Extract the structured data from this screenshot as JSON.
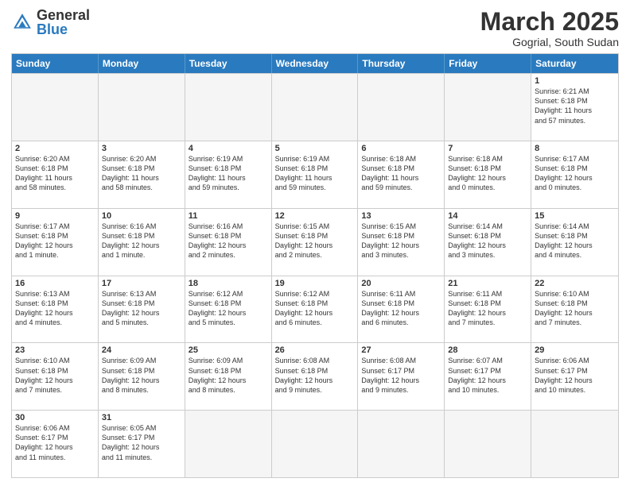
{
  "header": {
    "logo_general": "General",
    "logo_blue": "Blue",
    "month_title": "March 2025",
    "subtitle": "Gogrial, South Sudan"
  },
  "weekdays": [
    "Sunday",
    "Monday",
    "Tuesday",
    "Wednesday",
    "Thursday",
    "Friday",
    "Saturday"
  ],
  "rows": [
    [
      {
        "day": "",
        "info": "",
        "empty": true
      },
      {
        "day": "",
        "info": "",
        "empty": true
      },
      {
        "day": "",
        "info": "",
        "empty": true
      },
      {
        "day": "",
        "info": "",
        "empty": true
      },
      {
        "day": "",
        "info": "",
        "empty": true
      },
      {
        "day": "",
        "info": "",
        "empty": true
      },
      {
        "day": "1",
        "info": "Sunrise: 6:21 AM\nSunset: 6:18 PM\nDaylight: 11 hours\nand 57 minutes.",
        "empty": false
      }
    ],
    [
      {
        "day": "2",
        "info": "Sunrise: 6:20 AM\nSunset: 6:18 PM\nDaylight: 11 hours\nand 58 minutes.",
        "empty": false
      },
      {
        "day": "3",
        "info": "Sunrise: 6:20 AM\nSunset: 6:18 PM\nDaylight: 11 hours\nand 58 minutes.",
        "empty": false
      },
      {
        "day": "4",
        "info": "Sunrise: 6:19 AM\nSunset: 6:18 PM\nDaylight: 11 hours\nand 59 minutes.",
        "empty": false
      },
      {
        "day": "5",
        "info": "Sunrise: 6:19 AM\nSunset: 6:18 PM\nDaylight: 11 hours\nand 59 minutes.",
        "empty": false
      },
      {
        "day": "6",
        "info": "Sunrise: 6:18 AM\nSunset: 6:18 PM\nDaylight: 11 hours\nand 59 minutes.",
        "empty": false
      },
      {
        "day": "7",
        "info": "Sunrise: 6:18 AM\nSunset: 6:18 PM\nDaylight: 12 hours\nand 0 minutes.",
        "empty": false
      },
      {
        "day": "8",
        "info": "Sunrise: 6:17 AM\nSunset: 6:18 PM\nDaylight: 12 hours\nand 0 minutes.",
        "empty": false
      }
    ],
    [
      {
        "day": "9",
        "info": "Sunrise: 6:17 AM\nSunset: 6:18 PM\nDaylight: 12 hours\nand 1 minute.",
        "empty": false
      },
      {
        "day": "10",
        "info": "Sunrise: 6:16 AM\nSunset: 6:18 PM\nDaylight: 12 hours\nand 1 minute.",
        "empty": false
      },
      {
        "day": "11",
        "info": "Sunrise: 6:16 AM\nSunset: 6:18 PM\nDaylight: 12 hours\nand 2 minutes.",
        "empty": false
      },
      {
        "day": "12",
        "info": "Sunrise: 6:15 AM\nSunset: 6:18 PM\nDaylight: 12 hours\nand 2 minutes.",
        "empty": false
      },
      {
        "day": "13",
        "info": "Sunrise: 6:15 AM\nSunset: 6:18 PM\nDaylight: 12 hours\nand 3 minutes.",
        "empty": false
      },
      {
        "day": "14",
        "info": "Sunrise: 6:14 AM\nSunset: 6:18 PM\nDaylight: 12 hours\nand 3 minutes.",
        "empty": false
      },
      {
        "day": "15",
        "info": "Sunrise: 6:14 AM\nSunset: 6:18 PM\nDaylight: 12 hours\nand 4 minutes.",
        "empty": false
      }
    ],
    [
      {
        "day": "16",
        "info": "Sunrise: 6:13 AM\nSunset: 6:18 PM\nDaylight: 12 hours\nand 4 minutes.",
        "empty": false
      },
      {
        "day": "17",
        "info": "Sunrise: 6:13 AM\nSunset: 6:18 PM\nDaylight: 12 hours\nand 5 minutes.",
        "empty": false
      },
      {
        "day": "18",
        "info": "Sunrise: 6:12 AM\nSunset: 6:18 PM\nDaylight: 12 hours\nand 5 minutes.",
        "empty": false
      },
      {
        "day": "19",
        "info": "Sunrise: 6:12 AM\nSunset: 6:18 PM\nDaylight: 12 hours\nand 6 minutes.",
        "empty": false
      },
      {
        "day": "20",
        "info": "Sunrise: 6:11 AM\nSunset: 6:18 PM\nDaylight: 12 hours\nand 6 minutes.",
        "empty": false
      },
      {
        "day": "21",
        "info": "Sunrise: 6:11 AM\nSunset: 6:18 PM\nDaylight: 12 hours\nand 7 minutes.",
        "empty": false
      },
      {
        "day": "22",
        "info": "Sunrise: 6:10 AM\nSunset: 6:18 PM\nDaylight: 12 hours\nand 7 minutes.",
        "empty": false
      }
    ],
    [
      {
        "day": "23",
        "info": "Sunrise: 6:10 AM\nSunset: 6:18 PM\nDaylight: 12 hours\nand 7 minutes.",
        "empty": false
      },
      {
        "day": "24",
        "info": "Sunrise: 6:09 AM\nSunset: 6:18 PM\nDaylight: 12 hours\nand 8 minutes.",
        "empty": false
      },
      {
        "day": "25",
        "info": "Sunrise: 6:09 AM\nSunset: 6:18 PM\nDaylight: 12 hours\nand 8 minutes.",
        "empty": false
      },
      {
        "day": "26",
        "info": "Sunrise: 6:08 AM\nSunset: 6:18 PM\nDaylight: 12 hours\nand 9 minutes.",
        "empty": false
      },
      {
        "day": "27",
        "info": "Sunrise: 6:08 AM\nSunset: 6:17 PM\nDaylight: 12 hours\nand 9 minutes.",
        "empty": false
      },
      {
        "day": "28",
        "info": "Sunrise: 6:07 AM\nSunset: 6:17 PM\nDaylight: 12 hours\nand 10 minutes.",
        "empty": false
      },
      {
        "day": "29",
        "info": "Sunrise: 6:06 AM\nSunset: 6:17 PM\nDaylight: 12 hours\nand 10 minutes.",
        "empty": false
      }
    ],
    [
      {
        "day": "30",
        "info": "Sunrise: 6:06 AM\nSunset: 6:17 PM\nDaylight: 12 hours\nand 11 minutes.",
        "empty": false
      },
      {
        "day": "31",
        "info": "Sunrise: 6:05 AM\nSunset: 6:17 PM\nDaylight: 12 hours\nand 11 minutes.",
        "empty": false
      },
      {
        "day": "",
        "info": "",
        "empty": true
      },
      {
        "day": "",
        "info": "",
        "empty": true
      },
      {
        "day": "",
        "info": "",
        "empty": true
      },
      {
        "day": "",
        "info": "",
        "empty": true
      },
      {
        "day": "",
        "info": "",
        "empty": true
      }
    ]
  ]
}
